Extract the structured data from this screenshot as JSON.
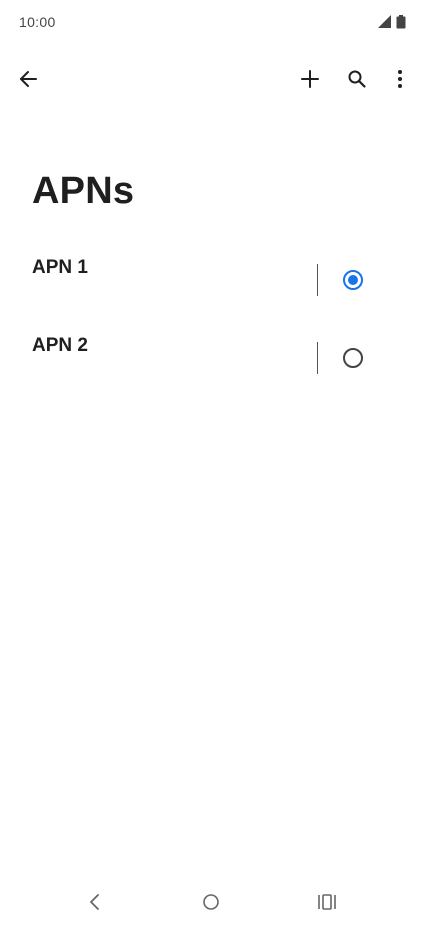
{
  "status_bar": {
    "time": "10:00",
    "icons": [
      "cellular-signal-icon",
      "battery-icon"
    ]
  },
  "toolbar": {
    "back_icon": "arrow-back-icon",
    "actions": [
      "add-icon",
      "search-icon",
      "more-vert-icon"
    ]
  },
  "page": {
    "title": "APNs"
  },
  "apns": [
    {
      "name": "APN 1",
      "selected": true
    },
    {
      "name": "APN 2",
      "selected": false
    }
  ],
  "navigation": {
    "icons": [
      "nav-back-icon",
      "nav-home-icon",
      "nav-recents-icon"
    ]
  },
  "colors": {
    "accent": "#1a73e8",
    "background": "#ffffff",
    "text": "#1f1f1f"
  }
}
